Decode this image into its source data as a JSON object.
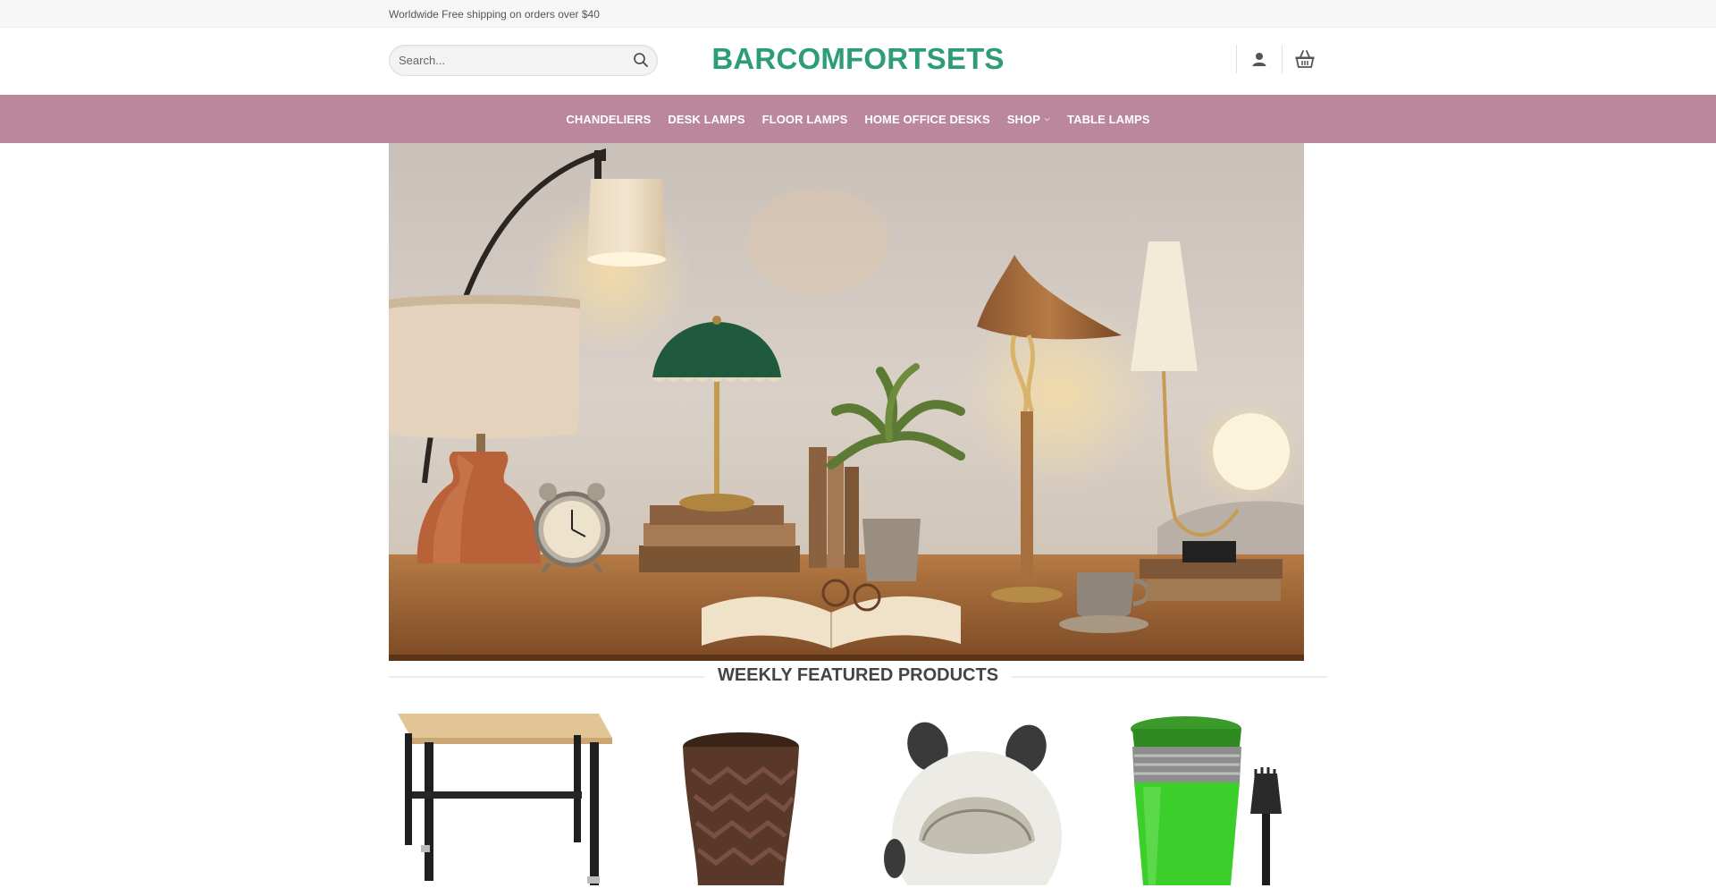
{
  "topbar": {
    "text": "Worldwide Free shipping on orders over $40"
  },
  "header": {
    "search": {
      "placeholder": "Search..."
    },
    "logo": "BARCOMFORTSETS",
    "icons": [
      "search-icon",
      "user-icon",
      "cart-icon"
    ]
  },
  "nav": {
    "items": [
      {
        "label": "CHANDELIERS"
      },
      {
        "label": "DESK LAMPS"
      },
      {
        "label": "FLOOR LAMPS"
      },
      {
        "label": "HOME OFFICE DESKS"
      },
      {
        "label": "SHOP",
        "has_dropdown": true
      },
      {
        "label": "TABLE LAMPS"
      }
    ]
  },
  "featured": {
    "title": "WEEKLY FEATURED PRODUCTS"
  },
  "products": [
    {
      "name": "workbench-desk"
    },
    {
      "name": "woven-vase"
    },
    {
      "name": "panda-ashtray"
    },
    {
      "name": "green-tumbler-with-brush"
    }
  ],
  "colors": {
    "brand": "#2d9c78",
    "nav_bg": "#ba879d",
    "topbar_bg": "#f7f7f7"
  }
}
